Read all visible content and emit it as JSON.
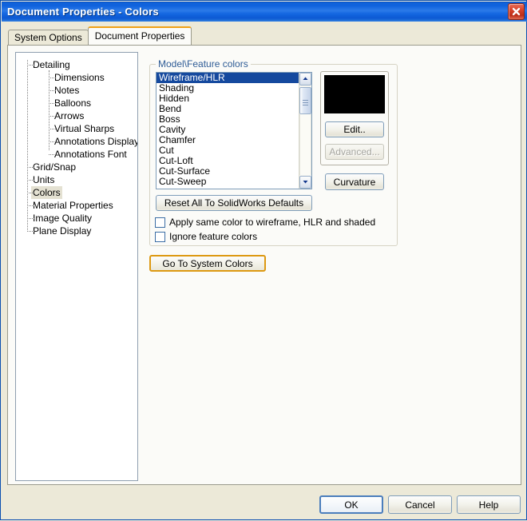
{
  "window": {
    "title": "Document Properties - Colors",
    "close_icon": "close-icon"
  },
  "tabs": [
    {
      "label": "System Options",
      "active": false
    },
    {
      "label": "Document Properties",
      "active": true
    }
  ],
  "tree": {
    "items": [
      {
        "label": "Detailing",
        "level": 0,
        "selected": false
      },
      {
        "label": "Dimensions",
        "level": 1,
        "selected": false
      },
      {
        "label": "Notes",
        "level": 1,
        "selected": false
      },
      {
        "label": "Balloons",
        "level": 1,
        "selected": false
      },
      {
        "label": "Arrows",
        "level": 1,
        "selected": false
      },
      {
        "label": "Virtual Sharps",
        "level": 1,
        "selected": false
      },
      {
        "label": "Annotations Display",
        "level": 1,
        "selected": false
      },
      {
        "label": "Annotations Font",
        "level": 1,
        "selected": false
      },
      {
        "label": "Grid/Snap",
        "level": 0,
        "selected": false
      },
      {
        "label": "Units",
        "level": 0,
        "selected": false
      },
      {
        "label": "Colors",
        "level": 0,
        "selected": true
      },
      {
        "label": "Material Properties",
        "level": 0,
        "selected": false
      },
      {
        "label": "Image Quality",
        "level": 0,
        "selected": false
      },
      {
        "label": "Plane Display",
        "level": 0,
        "selected": false
      }
    ]
  },
  "colors_panel": {
    "group_label": "Model\\Feature colors",
    "list_items": [
      {
        "label": "Wireframe/HLR",
        "selected": true
      },
      {
        "label": "Shading",
        "selected": false
      },
      {
        "label": "Hidden",
        "selected": false
      },
      {
        "label": "Bend",
        "selected": false
      },
      {
        "label": "Boss",
        "selected": false
      },
      {
        "label": "Cavity",
        "selected": false
      },
      {
        "label": "Chamfer",
        "selected": false
      },
      {
        "label": "Cut",
        "selected": false
      },
      {
        "label": "Cut-Loft",
        "selected": false
      },
      {
        "label": "Cut-Surface",
        "selected": false
      },
      {
        "label": "Cut-Sweep",
        "selected": false
      }
    ],
    "swatch_color": "#000000",
    "edit_label": "Edit..",
    "advanced_label": "Advanced...",
    "advanced_enabled": false,
    "curvature_label": "Curvature",
    "reset_label": "Reset All To SolidWorks Defaults",
    "checkbox_apply_same": {
      "label": "Apply same color to wireframe, HLR and shaded",
      "checked": false
    },
    "checkbox_ignore_feature": {
      "label": "Ignore feature colors",
      "checked": false
    },
    "go_to_system_colors_label": "Go To System Colors",
    "scrollbar": {
      "up_icon": "chevron-up-icon",
      "down_icon": "chevron-down-icon"
    }
  },
  "footer": {
    "ok_label": "OK",
    "cancel_label": "Cancel",
    "help_label": "Help"
  },
  "theme": {
    "accent_blue": "#15499e",
    "titlebar_blue": "#0f62dd",
    "highlight_gold": "#dd9912",
    "group_label_blue": "#2f5c96",
    "dialog_bg": "#ece9d8",
    "panel_bg": "#fbfbf8"
  }
}
